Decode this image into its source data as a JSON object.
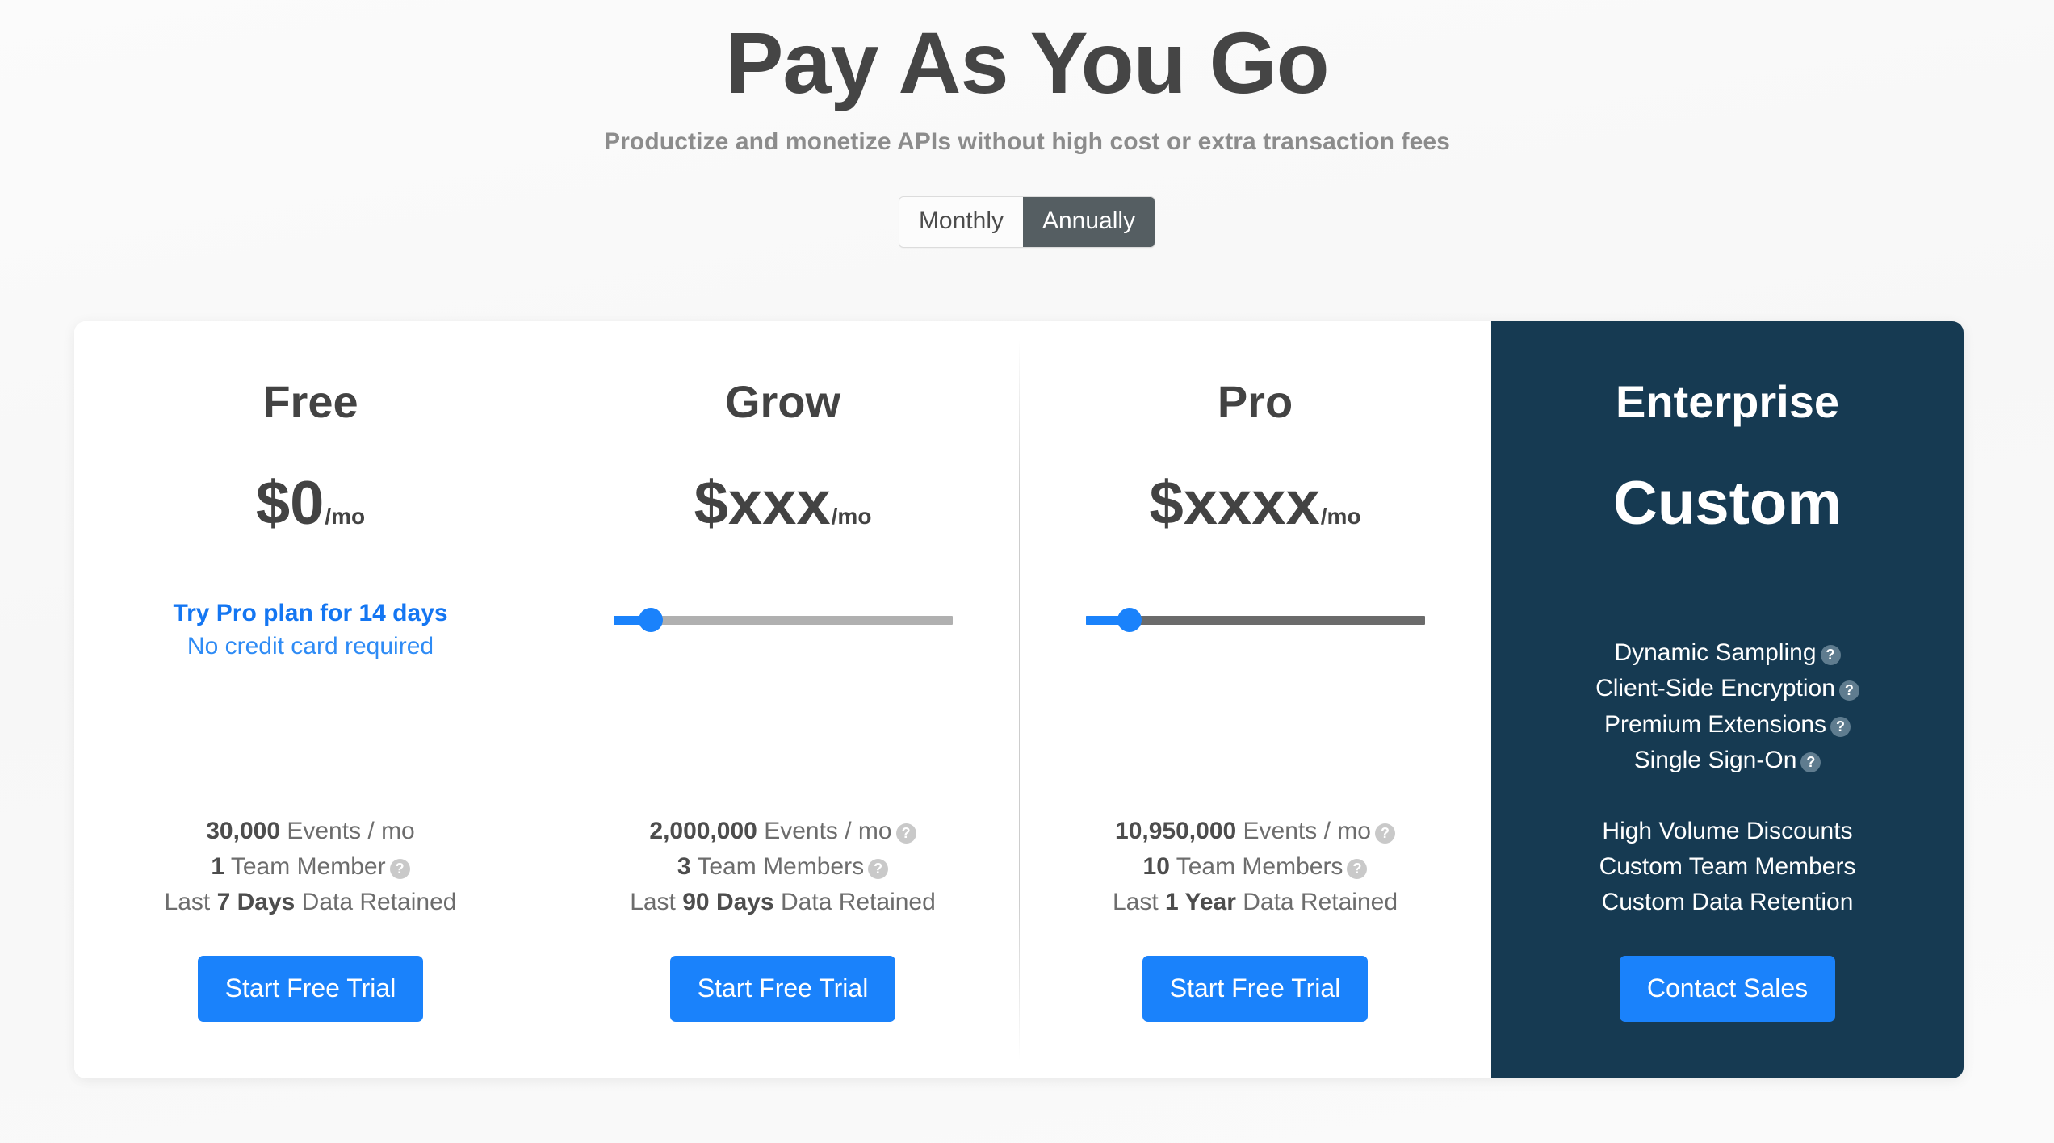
{
  "header": {
    "title": "Pay As You Go",
    "subtitle": "Productize and monetize APIs without high cost or extra transaction fees"
  },
  "billing_toggle": {
    "options": [
      "Monthly",
      "Annually"
    ],
    "monthly_label": "Monthly",
    "annually_label": "Annually",
    "selected": "Annually"
  },
  "colors": {
    "accent_blue": "#1a82fb",
    "enterprise_bg": "#163a52",
    "toggle_active_bg": "#555e62",
    "help_icon_gray": "#c9c9c9",
    "slider_track_grow": "#b0b0b0",
    "slider_track_pro": "#6b6b6b"
  },
  "plans": {
    "free": {
      "name": "Free",
      "price": "$0",
      "price_suffix": "/mo",
      "trial_line_1": "Try Pro plan for 14 days",
      "trial_line_2": "No credit card required",
      "events_value": "30,000",
      "events_label": " Events / mo",
      "events_help": false,
      "members_value": "1",
      "members_label": " Team Member",
      "members_help": true,
      "retention_prefix": "Last ",
      "retention_value": "7 Days",
      "retention_suffix": " Data Retained",
      "cta_label": "Start Free Trial"
    },
    "grow": {
      "name": "Grow",
      "price": "$xxx",
      "price_suffix": "/mo",
      "slider_percent": 11,
      "slider_track_color": "#b0b0b0",
      "events_value": "2,000,000",
      "events_label": " Events / mo",
      "events_help": true,
      "members_value": "3",
      "members_label": " Team Members",
      "members_help": true,
      "retention_prefix": "Last ",
      "retention_value": "90 Days",
      "retention_suffix": " Data Retained",
      "cta_label": "Start Free Trial"
    },
    "pro": {
      "name": "Pro",
      "price": "$xxxx",
      "price_suffix": "/mo",
      "slider_percent": 13,
      "slider_track_color": "#6b6b6b",
      "events_value": "10,950,000",
      "events_label": " Events / mo",
      "events_help": true,
      "members_value": "10",
      "members_label": " Team Members",
      "members_help": true,
      "retention_prefix": "Last ",
      "retention_value": "1 Year",
      "retention_suffix": " Data Retained",
      "cta_label": "Start Free Trial"
    },
    "enterprise": {
      "name": "Enterprise",
      "price": "Custom",
      "top_features": [
        "Dynamic Sampling",
        "Client-Side Encryption",
        "Premium Extensions",
        "Single Sign-On"
      ],
      "bottom_features": [
        "High Volume Discounts",
        "Custom Team Members",
        "Custom Data Retention"
      ],
      "cta_label": "Contact Sales"
    }
  },
  "icons": {
    "help": "?"
  }
}
